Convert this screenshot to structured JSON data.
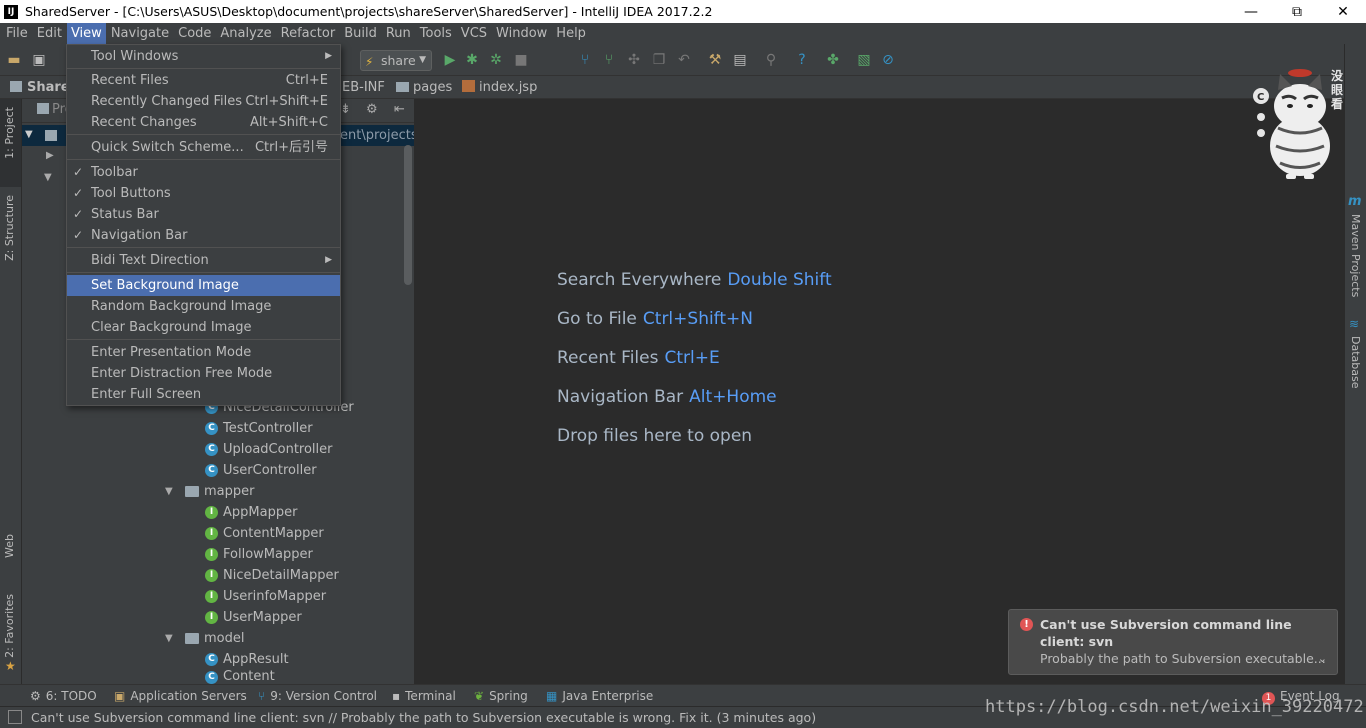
{
  "window": {
    "title": "SharedServer - [C:\\Users\\ASUS\\Desktop\\document\\projects\\shareServer\\SharedServer] - IntelliJ IDEA 2017.2.2",
    "logo": "IJ",
    "minimize": "—",
    "restore": "⧉",
    "close": "✕"
  },
  "menubar": {
    "items": [
      "File",
      "Edit",
      "View",
      "Navigate",
      "Code",
      "Analyze",
      "Refactor",
      "Build",
      "Run",
      "Tools",
      "VCS",
      "Window",
      "Help"
    ],
    "active": "View"
  },
  "toolbar": {
    "run_config": "share"
  },
  "navbar": {
    "root": "Shared",
    "crumbs": [
      "EB-INF",
      "pages",
      "index.jsp"
    ]
  },
  "project_panel": {
    "header": "Pro",
    "path_fragment": "ent\\projects\\s",
    "items": [
      {
        "label": "NiceDetailController",
        "kind": "class"
      },
      {
        "label": "TestController",
        "kind": "class"
      },
      {
        "label": "UploadController",
        "kind": "class"
      },
      {
        "label": "UserController",
        "kind": "class"
      },
      {
        "label": "mapper",
        "kind": "folder"
      },
      {
        "label": "AppMapper",
        "kind": "interface"
      },
      {
        "label": "ContentMapper",
        "kind": "interface"
      },
      {
        "label": "FollowMapper",
        "kind": "interface"
      },
      {
        "label": "NiceDetailMapper",
        "kind": "interface"
      },
      {
        "label": "UserinfoMapper",
        "kind": "interface"
      },
      {
        "label": "UserMapper",
        "kind": "interface"
      },
      {
        "label": "model",
        "kind": "folder"
      },
      {
        "label": "AppResult",
        "kind": "class"
      },
      {
        "label": "Content",
        "kind": "class"
      }
    ]
  },
  "view_menu": {
    "tool_windows": "Tool Windows",
    "recent_files": "Recent Files",
    "recent_files_sc": "Ctrl+E",
    "recently_changed": "Recently Changed Files",
    "recently_changed_sc": "Ctrl+Shift+E",
    "recent_changes": "Recent Changes",
    "recent_changes_sc": "Alt+Shift+C",
    "quick_switch": "Quick Switch Scheme...",
    "quick_switch_sc": "Ctrl+后引号",
    "toolbar": "Toolbar",
    "tool_buttons": "Tool Buttons",
    "status_bar": "Status Bar",
    "navigation_bar": "Navigation Bar",
    "bidi": "Bidi Text Direction",
    "set_bg": "Set Background Image",
    "random_bg": "Random Background Image",
    "clear_bg": "Clear Background Image",
    "presentation": "Enter Presentation Mode",
    "distraction": "Enter Distraction Free Mode",
    "fullscreen": "Enter Full Screen"
  },
  "editor": {
    "hints": [
      {
        "label": "Search Everywhere",
        "shortcut": "Double Shift"
      },
      {
        "label": "Go to File",
        "shortcut": "Ctrl+Shift+N"
      },
      {
        "label": "Recent Files",
        "shortcut": "Ctrl+E"
      },
      {
        "label": "Navigation Bar",
        "shortcut": "Alt+Home"
      },
      {
        "label": "Drop files here to open",
        "shortcut": ""
      }
    ]
  },
  "left_tabs": {
    "project": "1: Project",
    "structure": "Z: Structure",
    "web": "Web",
    "favorites": "2: Favorites"
  },
  "right_tabs": {
    "maven": "Maven Projects",
    "database": "Database",
    "cat_text": "没眼看"
  },
  "bottom_tabs": {
    "todo": "6: TODO",
    "app_servers": "Application Servers",
    "version_control": "9: Version Control",
    "terminal": "Terminal",
    "spring": "Spring",
    "java_ee": "Java Enterprise",
    "event_log": "Event Log",
    "event_count": "1"
  },
  "notification": {
    "title": "Can't use Subversion command line client: svn",
    "body": "Probably the path to Subversion executable..."
  },
  "status": {
    "message": "Can't use Subversion command line client: svn // Probably the path to Subversion executable is wrong. Fix it. (3 minutes ago)"
  },
  "watermark": "https://blog.csdn.net/weixin_39220472",
  "colors": {
    "accent": "#4b6eaf",
    "link": "#589df6",
    "panel": "#3c3f41",
    "editor": "#2b2b2b"
  }
}
